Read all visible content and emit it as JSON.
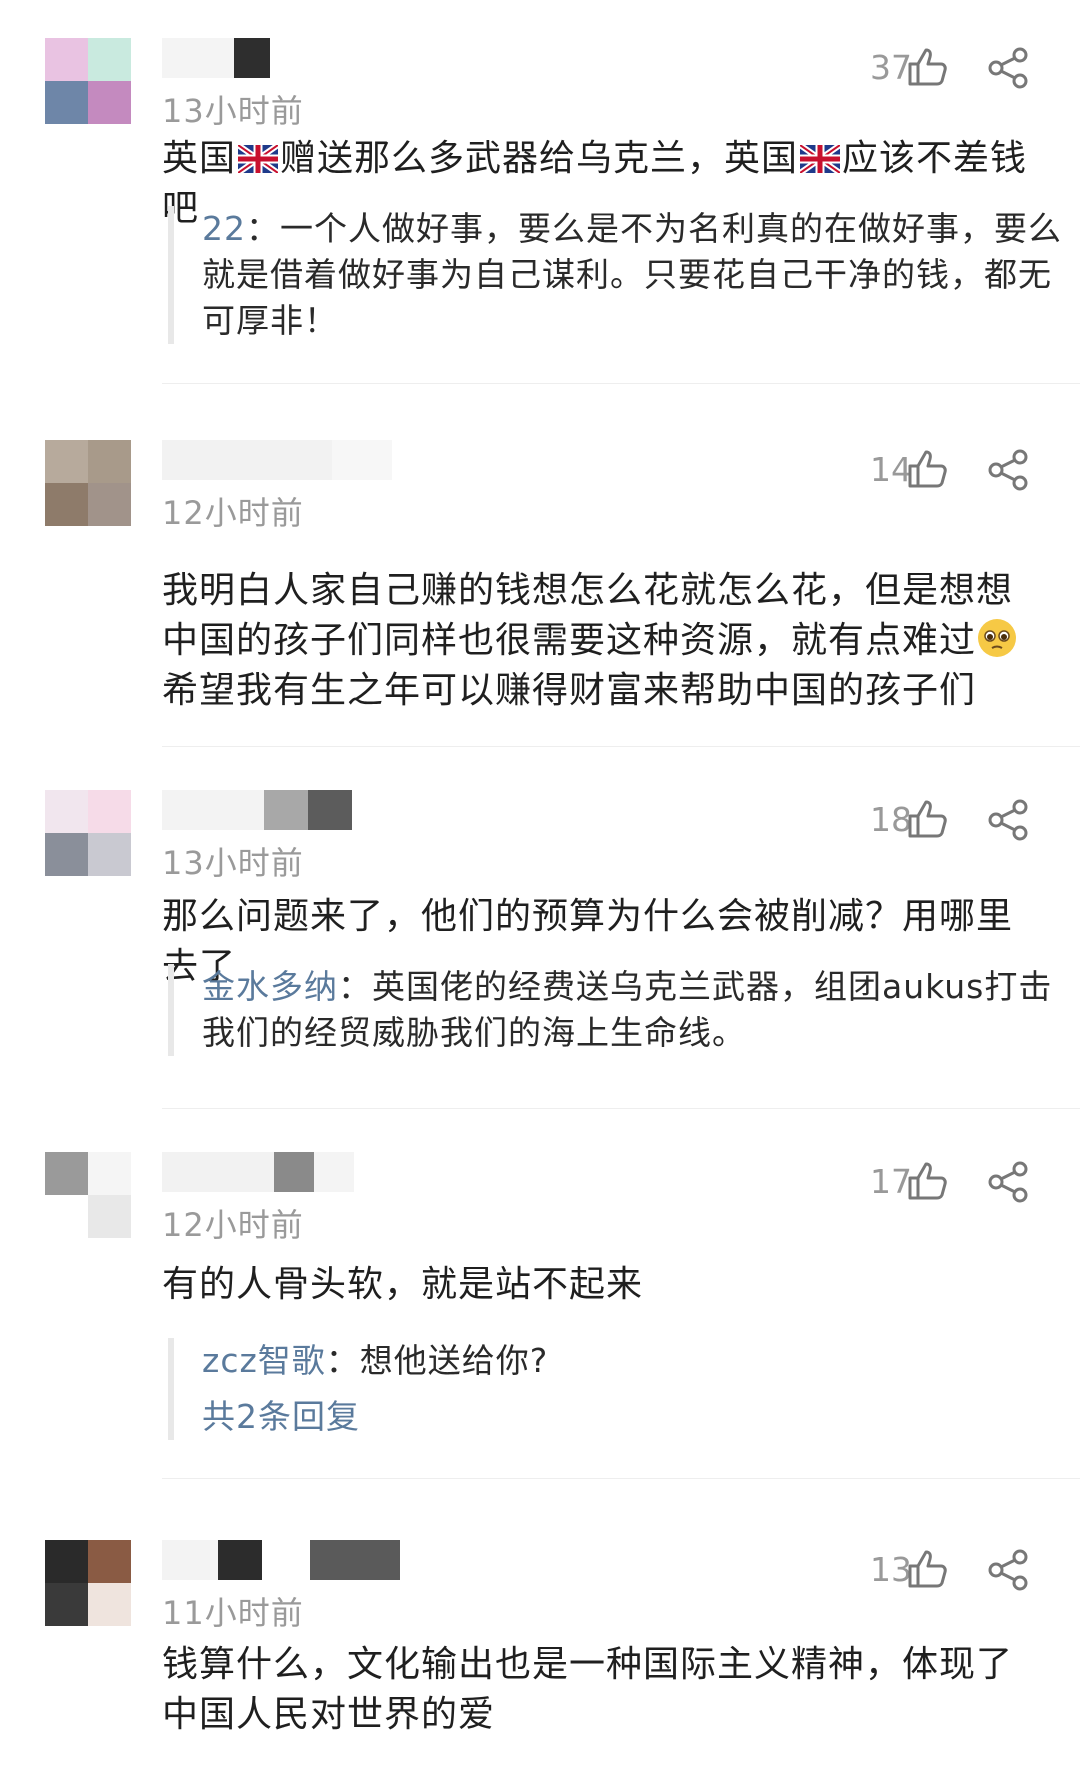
{
  "comments": [
    {
      "time": "13小时前",
      "likes": "37",
      "text_part1": "英国",
      "text_part2": "赠送那么多武器给乌克兰，英国",
      "text_part3": "应该不差钱吧",
      "reply": {
        "name": "22",
        "text": "：一个人做好事，要么是不为名利真的在做好事，要么就是借着做好事为自己谋利。只要花自己干净的钱，都无可厚非！"
      }
    },
    {
      "time": "12小时前",
      "likes": "14",
      "text_part1": "我明白人家自己赚的钱想怎么花就怎么花，但是想想中国的孩子们同样也很需要这种资源，就有点难过",
      "text_part2": "希望我有生之年可以赚得财富来帮助中国的孩子们"
    },
    {
      "time": "13小时前",
      "likes": "18",
      "text": "那么问题来了，他们的预算为什么会被削减？用哪里去了",
      "reply": {
        "name": "金水多纳",
        "text": "：英国佬的经费送乌克兰武器，组团aukus打击我们的经贸威胁我们的海上生命线。"
      }
    },
    {
      "time": "12小时前",
      "likes": "17",
      "text": "有的人骨头软，就是站不起来",
      "reply": {
        "name": "zcz智歌",
        "text": "：想他送给你?",
        "more": "共2条回复"
      }
    },
    {
      "time": "11小时前",
      "likes": "13",
      "text": "钱算什么，文化输出也是一种国际主义精神，体现了中国人民对世界的爱"
    }
  ],
  "icons": {
    "like": "thumbs-up-icon",
    "share": "share-icon",
    "flag": "uk-flag-icon",
    "emoji": "pleading-face-icon"
  },
  "colors": {
    "reply_name": "#5a7a9c",
    "meta": "#999999"
  }
}
